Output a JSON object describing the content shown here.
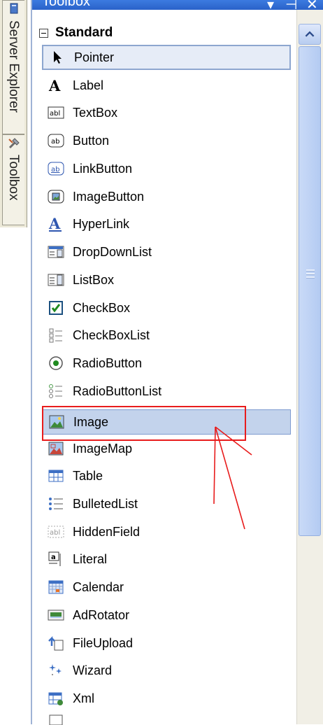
{
  "window": {
    "title": "Toolbox"
  },
  "title_buttons": {
    "dropdown": "▾",
    "pin": "⊣",
    "close": "✕"
  },
  "side_tabs": [
    {
      "label": "Server Explorer",
      "icon": "server-explorer-icon"
    },
    {
      "label": "Toolbox",
      "icon": "toolbox-icon"
    }
  ],
  "category": {
    "label": "Standard",
    "expanded": true
  },
  "items": [
    {
      "label": "Pointer",
      "icon": "pointer-icon",
      "state": "selected"
    },
    {
      "label": "Label",
      "icon": "label-icon"
    },
    {
      "label": "TextBox",
      "icon": "textbox-icon"
    },
    {
      "label": "Button",
      "icon": "button-icon"
    },
    {
      "label": "LinkButton",
      "icon": "linkbutton-icon"
    },
    {
      "label": "ImageButton",
      "icon": "imagebutton-icon"
    },
    {
      "label": "HyperLink",
      "icon": "hyperlink-icon"
    },
    {
      "label": "DropDownList",
      "icon": "dropdownlist-icon"
    },
    {
      "label": "ListBox",
      "icon": "listbox-icon"
    },
    {
      "label": "CheckBox",
      "icon": "checkbox-icon"
    },
    {
      "label": "CheckBoxList",
      "icon": "checkboxlist-icon"
    },
    {
      "label": "RadioButton",
      "icon": "radiobutton-icon"
    },
    {
      "label": "RadioButtonList",
      "icon": "radiobuttonlist-icon"
    },
    {
      "label": "Image",
      "icon": "image-icon",
      "state": "highlighted"
    },
    {
      "label": "ImageMap",
      "icon": "imagemap-icon"
    },
    {
      "label": "Table",
      "icon": "table-icon"
    },
    {
      "label": "BulletedList",
      "icon": "bulletedlist-icon"
    },
    {
      "label": "HiddenField",
      "icon": "hiddenfield-icon"
    },
    {
      "label": "Literal",
      "icon": "literal-icon"
    },
    {
      "label": "Calendar",
      "icon": "calendar-icon"
    },
    {
      "label": "AdRotator",
      "icon": "adrotator-icon"
    },
    {
      "label": "FileUpload",
      "icon": "fileupload-icon"
    },
    {
      "label": "Wizard",
      "icon": "wizard-icon"
    },
    {
      "label": "Xml",
      "icon": "xml-icon"
    }
  ],
  "colors": {
    "selection_border": "#8da6cf",
    "highlight": "#c3d3ec",
    "annotation": "#e81c1c",
    "title_bar": "#2a62c9"
  }
}
